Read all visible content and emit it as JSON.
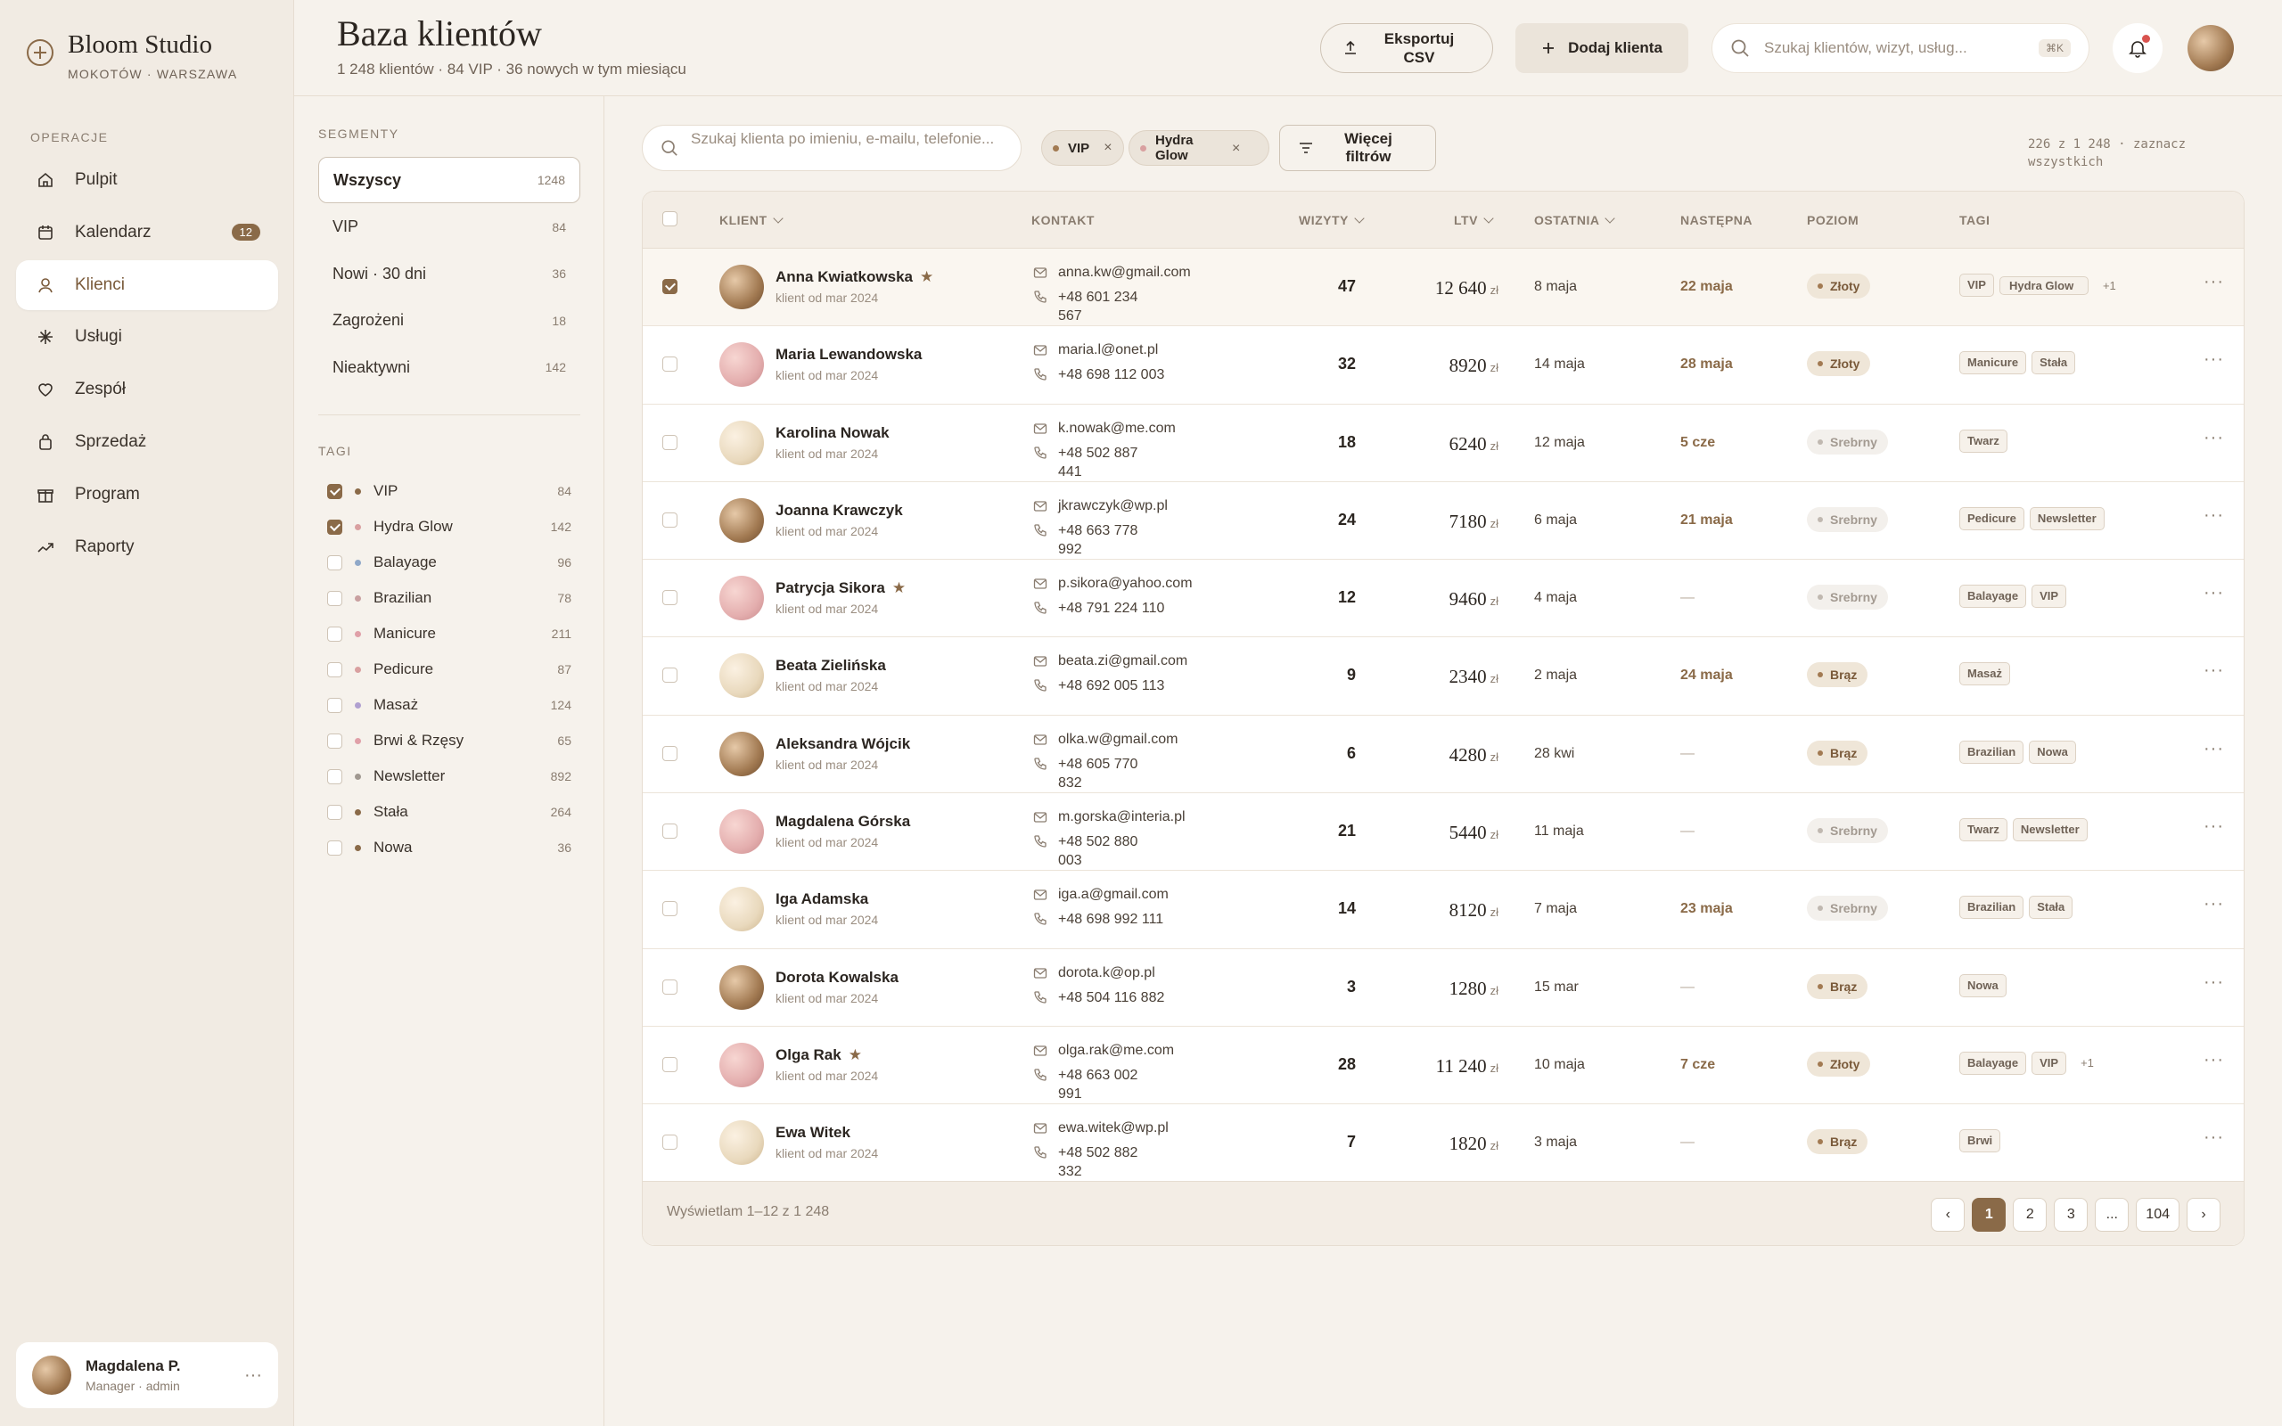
{
  "brand": {
    "name": "Bloom Studio",
    "location": "MOKOTÓW · WARSZAWA"
  },
  "nav": {
    "section_label": "OPERACJE",
    "items": [
      {
        "label": "Pulpit",
        "icon": "home-icon"
      },
      {
        "label": "Kalendarz",
        "icon": "calendar-icon",
        "badge": "12"
      },
      {
        "label": "Klienci",
        "icon": "user-icon",
        "active": true
      },
      {
        "label": "Usługi",
        "icon": "sparkle-icon"
      },
      {
        "label": "Zespół",
        "icon": "heart-icon"
      },
      {
        "label": "Sprzedaż",
        "icon": "bag-icon"
      },
      {
        "label": "Program",
        "icon": "gift-icon"
      },
      {
        "label": "Raporty",
        "icon": "trend-icon"
      }
    ]
  },
  "profile": {
    "name": "Magdalena P.",
    "role": "Manager · admin",
    "more": "···"
  },
  "header": {
    "title": "Baza klientów",
    "subtitle": "1 248 klientów · 84 VIP · 36 nowych w tym miesiącu",
    "export_label": "Eksportuj CSV",
    "add_label": "Dodaj klienta",
    "search_placeholder": "Szukaj klientów, wizyt, usług...",
    "search_shortcut": "⌘K"
  },
  "segments": {
    "label": "SEGMENTY",
    "items": [
      {
        "label": "Wszyscy",
        "count": "1248",
        "active": true
      },
      {
        "label": "VIP",
        "count": "84"
      },
      {
        "label": "Nowi · 30 dni",
        "count": "36"
      },
      {
        "label": "Zagrożeni",
        "count": "18"
      },
      {
        "label": "Nieaktywni",
        "count": "142"
      }
    ]
  },
  "tags_panel": {
    "label": "TAGI",
    "items": [
      {
        "label": "VIP",
        "count": "84",
        "checked": true,
        "color": "#8a6a48"
      },
      {
        "label": "Hydra Glow",
        "count": "142",
        "checked": true,
        "color": "#d9a0a0"
      },
      {
        "label": "Balayage",
        "count": "96",
        "checked": false,
        "color": "#8fa8c8"
      },
      {
        "label": "Brazilian",
        "count": "78",
        "checked": false,
        "color": "#c9a0a0"
      },
      {
        "label": "Manicure",
        "count": "211",
        "checked": false,
        "color": "#e0a0a8"
      },
      {
        "label": "Pedicure",
        "count": "87",
        "checked": false,
        "color": "#d9a0a0"
      },
      {
        "label": "Masaż",
        "count": "124",
        "checked": false,
        "color": "#b0a0d0"
      },
      {
        "label": "Brwi & Rzęsy",
        "count": "65",
        "checked": false,
        "color": "#e0a0a8"
      },
      {
        "label": "Newsletter",
        "count": "892",
        "checked": false,
        "color": "#a09890"
      },
      {
        "label": "Stała",
        "count": "264",
        "checked": false,
        "color": "#8a6a48"
      },
      {
        "label": "Nowa",
        "count": "36",
        "checked": false,
        "color": "#8a6a48"
      }
    ]
  },
  "filters": {
    "search_placeholder": "Szukaj klienta po imieniu, e-mailu, telefonie...",
    "chips": [
      {
        "label": "VIP",
        "color": "#a27a52",
        "remove": "×"
      },
      {
        "label": "Hydra Glow",
        "color": "#d9a0a0",
        "remove": "×"
      }
    ],
    "more_label": "Więcej filtrów",
    "count_note": "226 z 1 248 · zaznacz wszystkich"
  },
  "table": {
    "columns": {
      "client": "KLIENT",
      "contact": "KONTAKT",
      "visits": "WIZYTY",
      "ltv": "LTV",
      "last": "OSTATNIA",
      "next": "NASTĘPNA",
      "tier": "POZIOM",
      "tags": "TAGI"
    },
    "currency": "zł",
    "rows": [
      {
        "name": "Anna Kwiatkowska",
        "star": true,
        "since": "klient od mar 2024",
        "email": "anna.kw@gmail.com",
        "phone": "+48 601 234 567",
        "visits": "47",
        "ltv": "12 640",
        "last": "8 maja",
        "next": "22 maja",
        "tier": "Złoty",
        "tags": [
          "VIP",
          "Hydra Glow"
        ],
        "more": "+1",
        "avatar": "brown",
        "selected": true
      },
      {
        "name": "Maria Lewandowska",
        "star": false,
        "since": "klient od mar 2024",
        "email": "maria.l@onet.pl",
        "phone": "+48 698 112 003",
        "visits": "32",
        "ltv": "8920",
        "last": "14 maja",
        "next": "28 maja",
        "tier": "Złoty",
        "tags": [
          "Manicure",
          "Stała"
        ],
        "more": "",
        "avatar": "pink"
      },
      {
        "name": "Karolina Nowak",
        "star": false,
        "since": "klient od mar 2024",
        "email": "k.nowak@me.com",
        "phone": "+48 502 887 441",
        "visits": "18",
        "ltv": "6240",
        "last": "12 maja",
        "next": "5 cze",
        "tier": "Srebrny",
        "tags": [
          "Twarz"
        ],
        "more": "",
        "avatar": "cream"
      },
      {
        "name": "Joanna Krawczyk",
        "star": false,
        "since": "klient od mar 2024",
        "email": "jkrawczyk@wp.pl",
        "phone": "+48 663 778 992",
        "visits": "24",
        "ltv": "7180",
        "last": "6 maja",
        "next": "21 maja",
        "tier": "Srebrny",
        "tags": [
          "Pedicure",
          "Newsletter"
        ],
        "more": "",
        "avatar": "brown"
      },
      {
        "name": "Patrycja Sikora",
        "star": true,
        "since": "klient od mar 2024",
        "email": "p.sikora@yahoo.com",
        "phone": "+48 791 224 110",
        "visits": "12",
        "ltv": "9460",
        "last": "4 maja",
        "next": "—",
        "tier": "Srebrny",
        "tags": [
          "Balayage",
          "VIP"
        ],
        "more": "",
        "avatar": "pink"
      },
      {
        "name": "Beata Zielińska",
        "star": false,
        "since": "klient od mar 2024",
        "email": "beata.zi@gmail.com",
        "phone": "+48 692 005 113",
        "visits": "9",
        "ltv": "2340",
        "last": "2 maja",
        "next": "24 maja",
        "tier": "Brąz",
        "tags": [
          "Masaż"
        ],
        "more": "",
        "avatar": "cream"
      },
      {
        "name": "Aleksandra Wójcik",
        "star": false,
        "since": "klient od mar 2024",
        "email": "olka.w@gmail.com",
        "phone": "+48 605 770 832",
        "visits": "6",
        "ltv": "4280",
        "last": "28 kwi",
        "next": "—",
        "tier": "Brąz",
        "tags": [
          "Brazilian",
          "Nowa"
        ],
        "more": "",
        "avatar": "brown"
      },
      {
        "name": "Magdalena Górska",
        "star": false,
        "since": "klient od mar 2024",
        "email": "m.gorska@interia.pl",
        "phone": "+48 502 880 003",
        "visits": "21",
        "ltv": "5440",
        "last": "11 maja",
        "next": "—",
        "tier": "Srebrny",
        "tags": [
          "Twarz",
          "Newsletter"
        ],
        "more": "",
        "avatar": "pink"
      },
      {
        "name": "Iga Adamska",
        "star": false,
        "since": "klient od mar 2024",
        "email": "iga.a@gmail.com",
        "phone": "+48 698 992 111",
        "visits": "14",
        "ltv": "8120",
        "last": "7 maja",
        "next": "23 maja",
        "tier": "Srebrny",
        "tags": [
          "Brazilian",
          "Stała"
        ],
        "more": "",
        "avatar": "cream"
      },
      {
        "name": "Dorota Kowalska",
        "star": false,
        "since": "klient od mar 2024",
        "email": "dorota.k@op.pl",
        "phone": "+48 504 116 882",
        "visits": "3",
        "ltv": "1280",
        "last": "15 mar",
        "next": "—",
        "tier": "Brąz",
        "tags": [
          "Nowa"
        ],
        "more": "",
        "avatar": "brown"
      },
      {
        "name": "Olga Rak",
        "star": true,
        "since": "klient od mar 2024",
        "email": "olga.rak@me.com",
        "phone": "+48 663 002 991",
        "visits": "28",
        "ltv": "11 240",
        "last": "10 maja",
        "next": "7 cze",
        "tier": "Złoty",
        "tags": [
          "Balayage",
          "VIP"
        ],
        "more": "+1",
        "avatar": "pink"
      },
      {
        "name": "Ewa Witek",
        "star": false,
        "since": "klient od mar 2024",
        "email": "ewa.witek@wp.pl",
        "phone": "+48 502 882 332",
        "visits": "7",
        "ltv": "1820",
        "last": "3 maja",
        "next": "—",
        "tier": "Brąz",
        "tags": [
          "Brwi"
        ],
        "more": "",
        "avatar": "cream"
      }
    ]
  },
  "footer": {
    "note": "Wyświetlam 1–12 z 1 248",
    "pages": [
      "‹",
      "1",
      "2",
      "3",
      "...",
      "104",
      "›"
    ],
    "current_page": "1"
  }
}
